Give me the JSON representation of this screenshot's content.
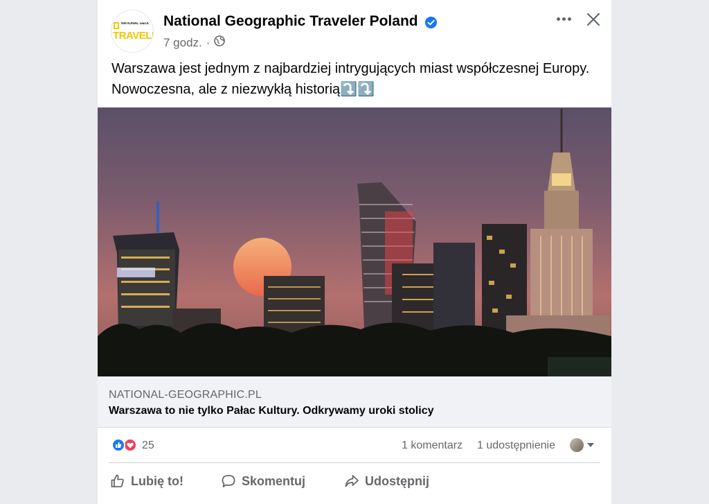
{
  "post": {
    "page_name": "National Geographic Traveler Poland",
    "time": "7 godz.",
    "separator": "·",
    "text": "Warszawa jest jednym z najbardziej intrygujących miast współczesnej Europy. Nowoczesna, ale z niezwykłą historią⤵️⤵️",
    "avatar": {
      "logo_small": "NATIONAL GEOGRAPHIC",
      "logo_word": "TRAVELER"
    }
  },
  "link_preview": {
    "domain": "NATIONAL-GEOGRAPHIC.PL",
    "title": "Warszawa to nie tylko Pałac Kultury. Odkrywamy uroki stolicy"
  },
  "stats": {
    "reactions": "25",
    "comments": "1 komentarz",
    "shares": "1 udostępnienie"
  },
  "actions": {
    "like": "Lubię to!",
    "comment": "Skomentuj",
    "share": "Udostępnij"
  },
  "colors": {
    "accent": "#1877f2",
    "love": "#f33e58",
    "secondary_text": "#65676b",
    "logo_yellow": "#f5c400"
  },
  "icons": [
    "verified-icon",
    "globe-icon",
    "more-icon",
    "close-icon",
    "like-reaction-icon",
    "love-reaction-icon",
    "thumbs-up-icon",
    "comment-icon",
    "share-icon",
    "chevron-down-icon"
  ]
}
